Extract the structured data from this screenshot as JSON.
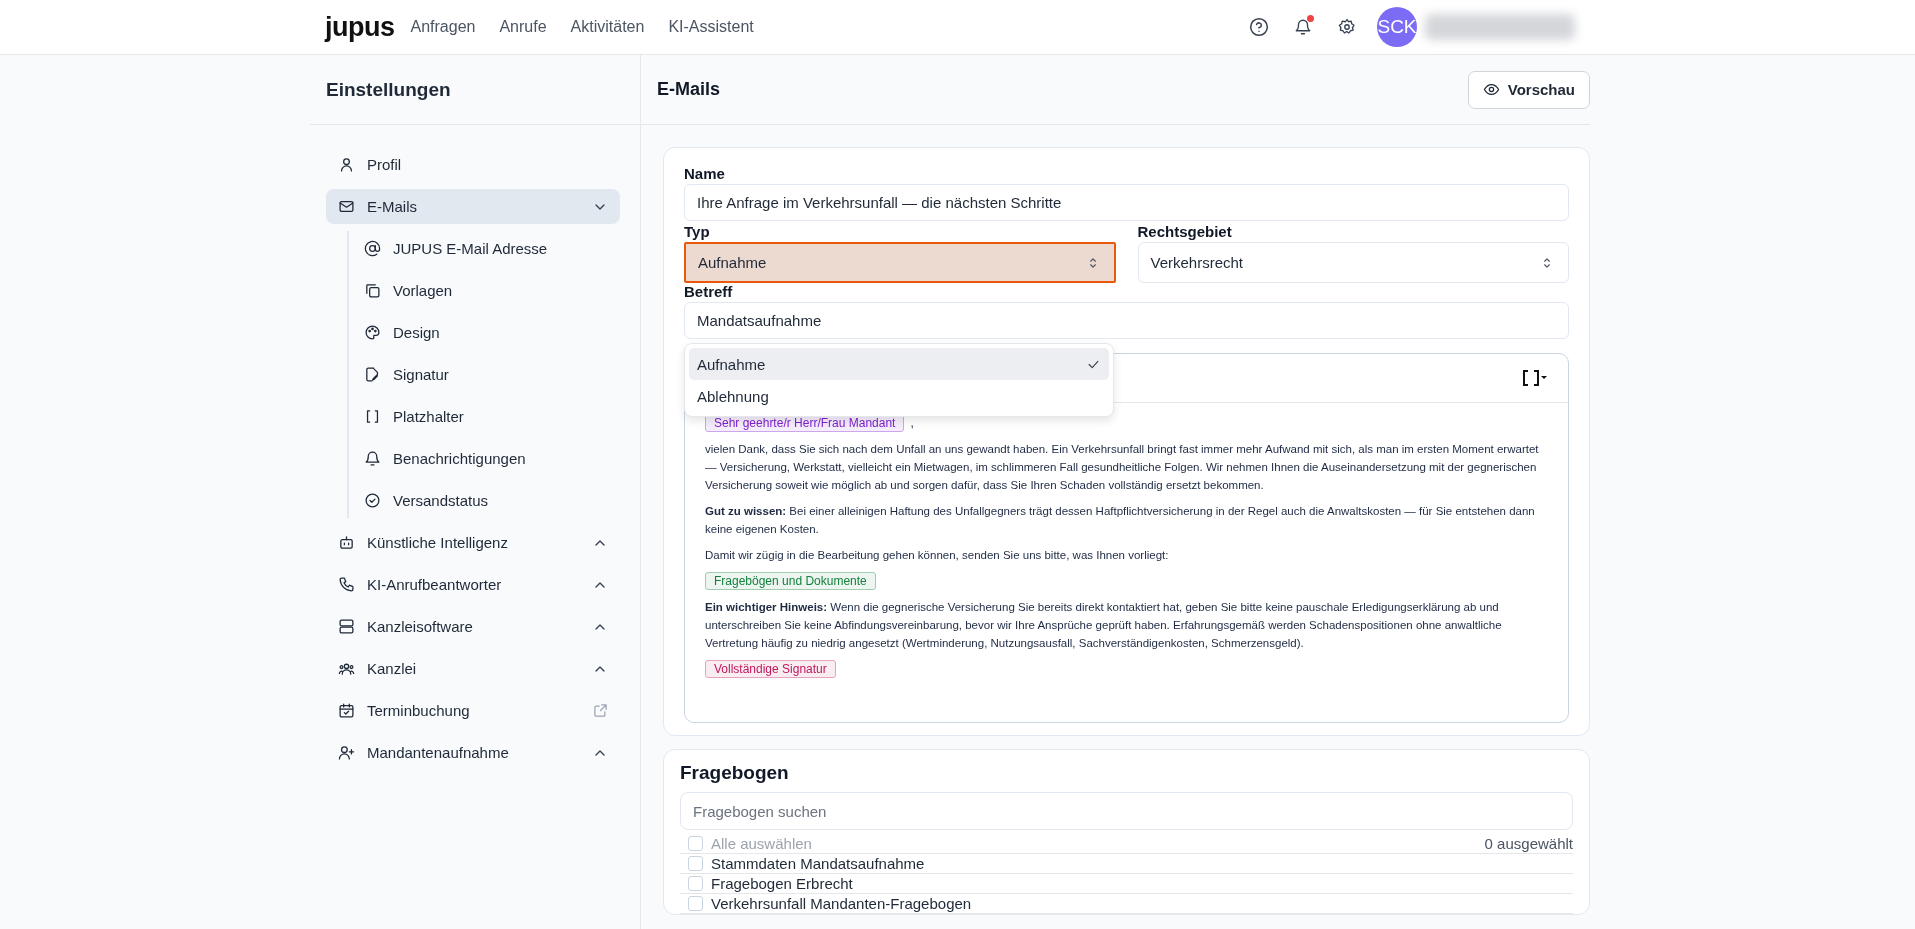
{
  "topbar": {
    "logo": "jupus",
    "nav": [
      {
        "label": "Anfragen"
      },
      {
        "label": "Anrufe"
      },
      {
        "label": "Aktivitäten"
      },
      {
        "label": "KI-Assistent"
      }
    ],
    "notification": true,
    "avatar": "SCK"
  },
  "sidebar": {
    "title": "Einstellungen",
    "items": [
      {
        "label": "Profil",
        "kind": "page",
        "selected": false
      },
      {
        "label": "E-Mails",
        "kind": "group",
        "selected": true,
        "expanded": true,
        "children": [
          {
            "label": "JUPUS E-Mail Adresse",
            "selected": false
          },
          {
            "label": "Vorlagen",
            "selected": false
          },
          {
            "label": "Design",
            "selected": false
          },
          {
            "label": "Signatur",
            "selected": false
          },
          {
            "label": "Platzhalter",
            "selected": false
          },
          {
            "label": "Benachrichtigungen",
            "selected": false
          },
          {
            "label": "Versandstatus",
            "selected": false
          }
        ]
      },
      {
        "label": "Künstliche Intelligenz",
        "kind": "group",
        "selected": false,
        "expanded": false
      },
      {
        "label": "KI-Anrufbeantworter",
        "kind": "group",
        "selected": false,
        "expanded": false
      },
      {
        "label": "Kanzleisoftware",
        "kind": "group",
        "selected": false,
        "expanded": false
      },
      {
        "label": "Kanzlei",
        "kind": "group",
        "selected": false,
        "expanded": false
      },
      {
        "label": "Terminbuchung",
        "kind": "external",
        "selected": false
      },
      {
        "label": "Mandantenaufnahme",
        "kind": "group",
        "selected": false,
        "expanded": false
      }
    ]
  },
  "main": {
    "title": "E-Mails",
    "preview_button": "Vorschau",
    "form": {
      "name": {
        "label": "Name",
        "value": "Ihre Anfrage im Verkehrsunfall — die nächsten Schritte"
      },
      "typ": {
        "label": "Typ",
        "value": "Aufnahme",
        "focused": true,
        "open": true,
        "options": [
          {
            "label": "Aufnahme",
            "selected": true
          },
          {
            "label": "Ablehnung",
            "selected": false
          }
        ]
      },
      "rechtsgebiet": {
        "label": "Rechtsgebiet",
        "value": "Verkehrsrecht",
        "focused": false
      },
      "betreff": {
        "label": "Betreff",
        "value": "Mandatsaufnahme"
      },
      "editor": {
        "blocks": [
          {
            "kind": "placeholder",
            "text": "Sehr geehrte/r Herr/Frau Mandant",
            "color": "#7e22ce",
            "suffix": ","
          },
          {
            "kind": "paragraph",
            "text": "vielen Dank, dass Sie sich nach dem Unfall an uns gewandt haben. Ein Verkehrsunfall bringt fast immer mehr Aufwand mit sich, als man im ersten Moment erwartet — Versicherung, Werkstatt, vielleicht ein Mietwagen, im schlimmeren Fall gesundheitliche Folgen. Wir nehmen Ihnen die Auseinandersetzung mit der gegnerischen Versicherung soweit wie möglich ab und sorgen dafür, dass Sie Ihren Schaden vollständig ersetzt bekommen."
          },
          {
            "kind": "paragraph",
            "text": "**Gut zu wissen:** Bei einer alleinigen Haftung des Unfallgegners trägt dessen Haftpflichtversicherung in der Regel auch die Anwaltskosten — für Sie entstehen dann keine eigenen Kosten."
          },
          {
            "kind": "paragraph",
            "text": "Damit wir zügig in die Bearbeitung gehen können, senden Sie uns bitte, was Ihnen vorliegt:"
          },
          {
            "kind": "placeholder",
            "text": "Fragebögen und Dokumente",
            "color": "#15803d"
          },
          {
            "kind": "paragraph",
            "text": "**Ein wichtiger Hinweis:** Wenn die gegnerische Versicherung Sie bereits direkt kontaktiert hat, geben Sie bitte keine pauschale Erledigungserklärung ab und unterschreiben Sie keine Abfindungsvereinbarung, bevor wir Ihre Ansprüche geprüft haben. Erfahrungsgemäß werden Schadenspositionen ohne anwaltliche Vertretung häufig zu niedrig angesetzt (Wertminderung, Nutzungsausfall, Sachverständigenkosten, Schmerzensgeld)."
          },
          {
            "kind": "placeholder",
            "text": "Vollständige Signatur",
            "color": "#be185d"
          }
        ]
      }
    }
  },
  "fragebogen": {
    "title": "Fragebogen",
    "search_placeholder": "Fragebogen suchen",
    "select_all": {
      "label": "Alle auswählen",
      "checked": false,
      "disabled": true
    },
    "count": "0 ausgewählt",
    "items": [
      {
        "label": "Stammdaten Mandatsaufnahme",
        "checked": false
      },
      {
        "label": "Fragebogen Erbrecht",
        "checked": false
      },
      {
        "label": "Verkehrsunfall Mandanten-Fragebogen",
        "checked": false
      }
    ]
  }
}
